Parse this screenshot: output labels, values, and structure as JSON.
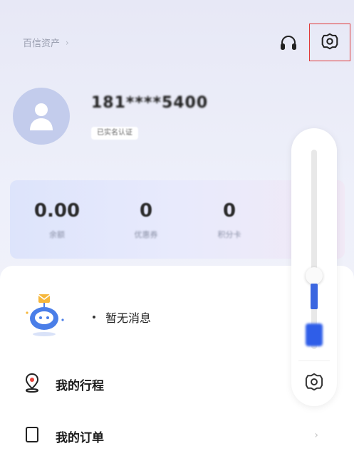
{
  "header": {
    "assets_label": "百信资产",
    "chevron": "›",
    "headset_icon": "headset-icon",
    "settings_icon": "gear-icon",
    "highlight_color": "#e03a3a"
  },
  "profile": {
    "phone": "181****5400",
    "status_tag": "已实名认证",
    "avatar_icon": "user-silhouette-icon"
  },
  "stats": [
    {
      "value": "0.00",
      "label": "余额"
    },
    {
      "value": "0",
      "label": "优惠券"
    },
    {
      "value": "0",
      "label": "积分卡"
    }
  ],
  "messages": {
    "empty_text": "暂无消息",
    "robot_icon": "robot-mail-icon"
  },
  "menu": {
    "trip_label": "我的行程",
    "trip_icon": "location-pin-icon",
    "orders_label": "我的订单",
    "orders_icon": "order-icon",
    "chevron": "›"
  },
  "slider": {
    "settings_icon": "gear-icon",
    "accent_color": "#3b66e0"
  }
}
